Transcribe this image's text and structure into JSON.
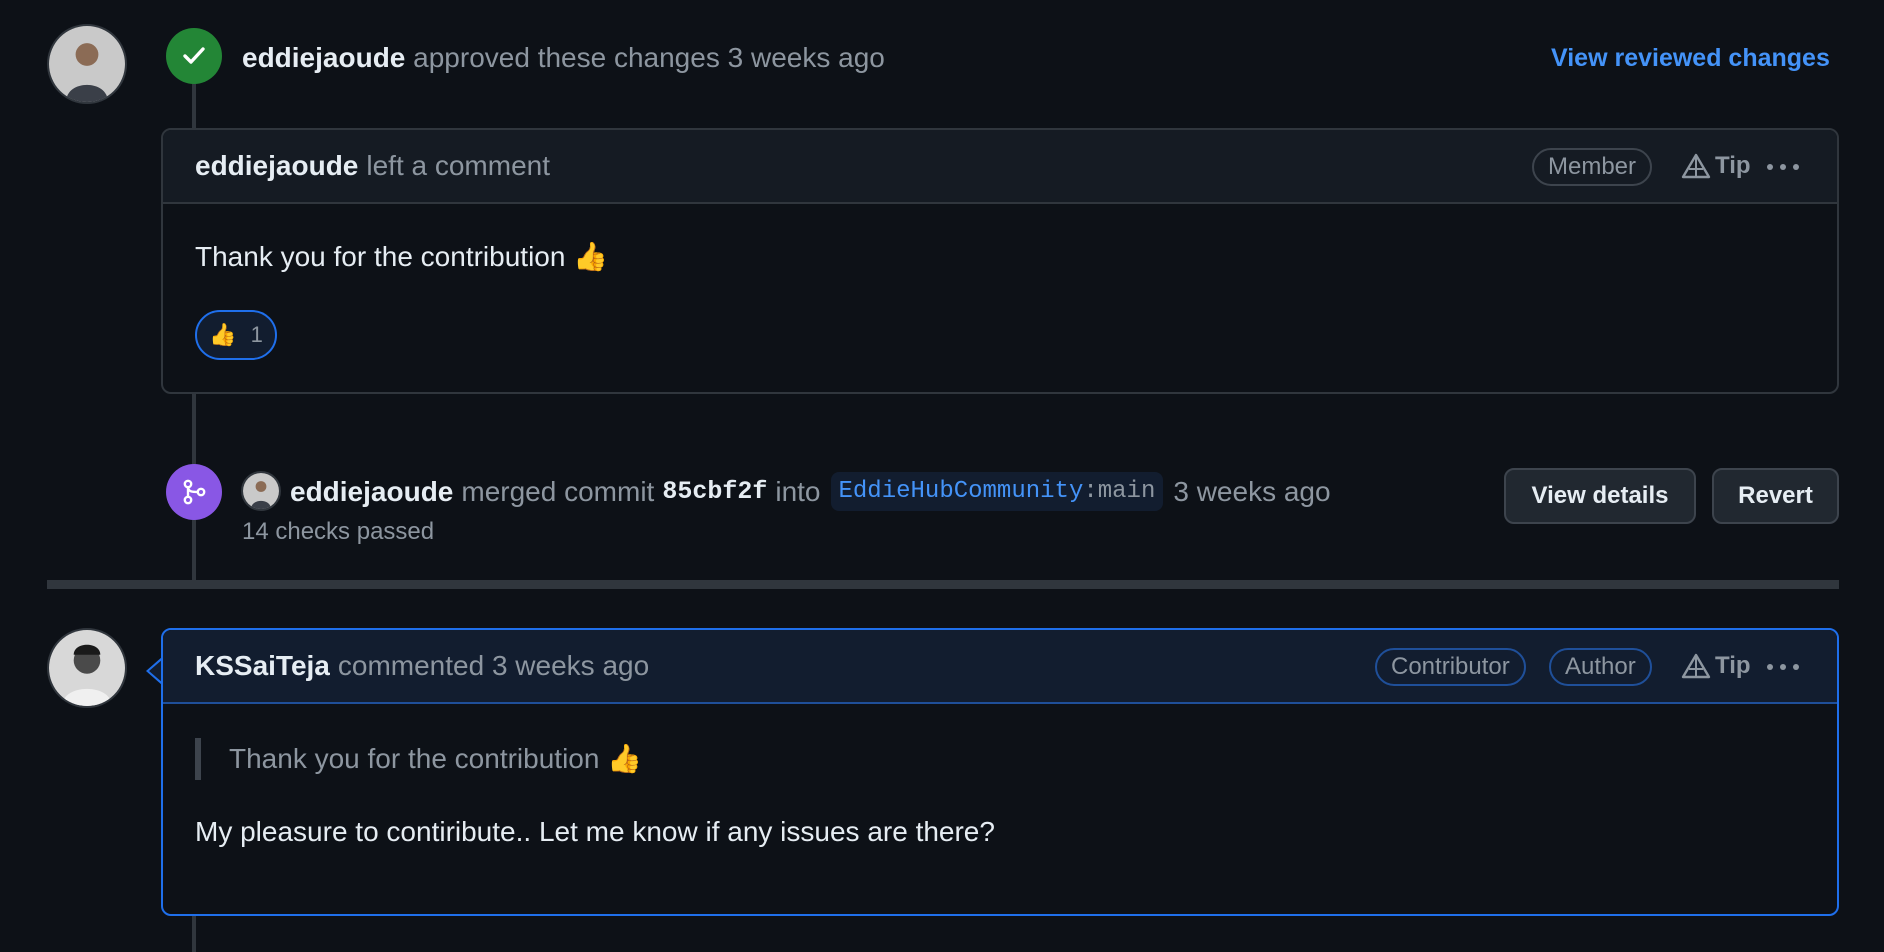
{
  "review": {
    "author": "eddiejaoude",
    "action": "approved these changes",
    "time": "3 weeks ago",
    "view_link": "View reviewed changes"
  },
  "comment1": {
    "author": "eddiejaoude",
    "action": "left a comment",
    "badge": "Member",
    "tip": "Tip",
    "body": "Thank you for the contribution 👍",
    "reaction_emoji": "👍",
    "reaction_count": "1"
  },
  "merge": {
    "author": "eddiejaoude",
    "action": "merged commit",
    "commit": "85cbf2f",
    "into": "into",
    "branch_repo": "EddieHubCommunity",
    "branch_sep": ":",
    "branch_name": "main",
    "time": "3 weeks ago",
    "checks": "14 checks passed",
    "view_details": "View details",
    "revert": "Revert"
  },
  "comment2": {
    "author": "KSSaiTeja",
    "action": "commented 3 weeks ago",
    "badge_contributor": "Contributor",
    "badge_author": "Author",
    "tip": "Tip",
    "quote": "Thank you for the contribution 👍",
    "body": "My pleasure to contiribute.. Let me know if any issues are there?"
  },
  "colors": {
    "background": "#0d1117",
    "approved_green": "#238636",
    "merged_purple": "#8957e5",
    "link_blue": "#4493f8"
  }
}
